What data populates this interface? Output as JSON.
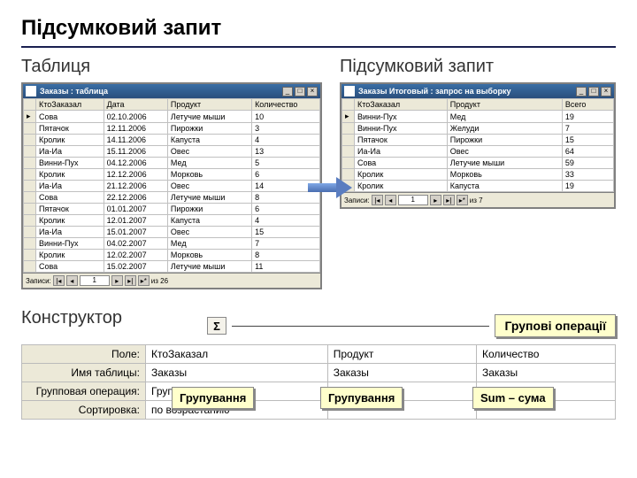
{
  "title": "Підсумковий запит",
  "labels": {
    "table": "Таблиця",
    "summary_query": "Підсумковий запит",
    "constructor": "Конструктор",
    "group_ops": "Групові операції",
    "grouping": "Групування",
    "sum": "Sum – сума",
    "sigma": "Σ"
  },
  "left_window": {
    "title": "Заказы : таблица",
    "columns": [
      "КтоЗаказал",
      "Дата",
      "Продукт",
      "Количество"
    ],
    "rows": [
      [
        "Сова",
        "02.10.2006",
        "Летучие мыши",
        "10"
      ],
      [
        "Пятачок",
        "12.11.2006",
        "Пирожки",
        "3"
      ],
      [
        "Кролик",
        "14.11.2006",
        "Капуста",
        "4"
      ],
      [
        "Иа-Иа",
        "15.11.2006",
        "Овес",
        "13"
      ],
      [
        "Винни-Пух",
        "04.12.2006",
        "Мед",
        "5"
      ],
      [
        "Кролик",
        "12.12.2006",
        "Морковь",
        "6"
      ],
      [
        "Иа-Иа",
        "21.12.2006",
        "Овес",
        "14"
      ],
      [
        "Сова",
        "22.12.2006",
        "Летучие мыши",
        "8"
      ],
      [
        "Пятачок",
        "01.01.2007",
        "Пирожки",
        "6"
      ],
      [
        "Кролик",
        "12.01.2007",
        "Капуста",
        "4"
      ],
      [
        "Иа-Иа",
        "15.01.2007",
        "Овес",
        "15"
      ],
      [
        "Винни-Пух",
        "04.02.2007",
        "Мед",
        "7"
      ],
      [
        "Кролик",
        "12.02.2007",
        "Морковь",
        "8"
      ],
      [
        "Сова",
        "15.02.2007",
        "Летучие мыши",
        "11"
      ]
    ],
    "nav": {
      "label": "Записи:",
      "value": "1",
      "of": "из 26"
    }
  },
  "right_window": {
    "title": "Заказы Итоговый : запрос на выборку",
    "columns": [
      "КтоЗаказал",
      "Продукт",
      "Всего"
    ],
    "rows": [
      [
        "Винни-Пух",
        "Мед",
        "19"
      ],
      [
        "Винни-Пух",
        "Желуди",
        "7"
      ],
      [
        "Пятачок",
        "Пирожки",
        "15"
      ],
      [
        "Иа-Иа",
        "Овес",
        "64"
      ],
      [
        "Сова",
        "Летучие мыши",
        "59"
      ],
      [
        "Кролик",
        "Морковь",
        "33"
      ],
      [
        "Кролик",
        "Капуста",
        "19"
      ]
    ],
    "nav": {
      "label": "Записи:",
      "value": "1",
      "of": "из 7"
    }
  },
  "designer": {
    "row_labels": [
      "Поле:",
      "Имя таблицы:",
      "Групповая операция:",
      "Сортировка:"
    ],
    "cols": [
      {
        "field": "КтоЗаказал",
        "table": "Заказы",
        "op": "Группировка",
        "sort": "по возрастанию"
      },
      {
        "field": "Продукт",
        "table": "Заказы",
        "op": "Группировка",
        "sort": ""
      },
      {
        "field": "Количество",
        "table": "Заказы",
        "op": "Sum",
        "sort": ""
      }
    ]
  }
}
